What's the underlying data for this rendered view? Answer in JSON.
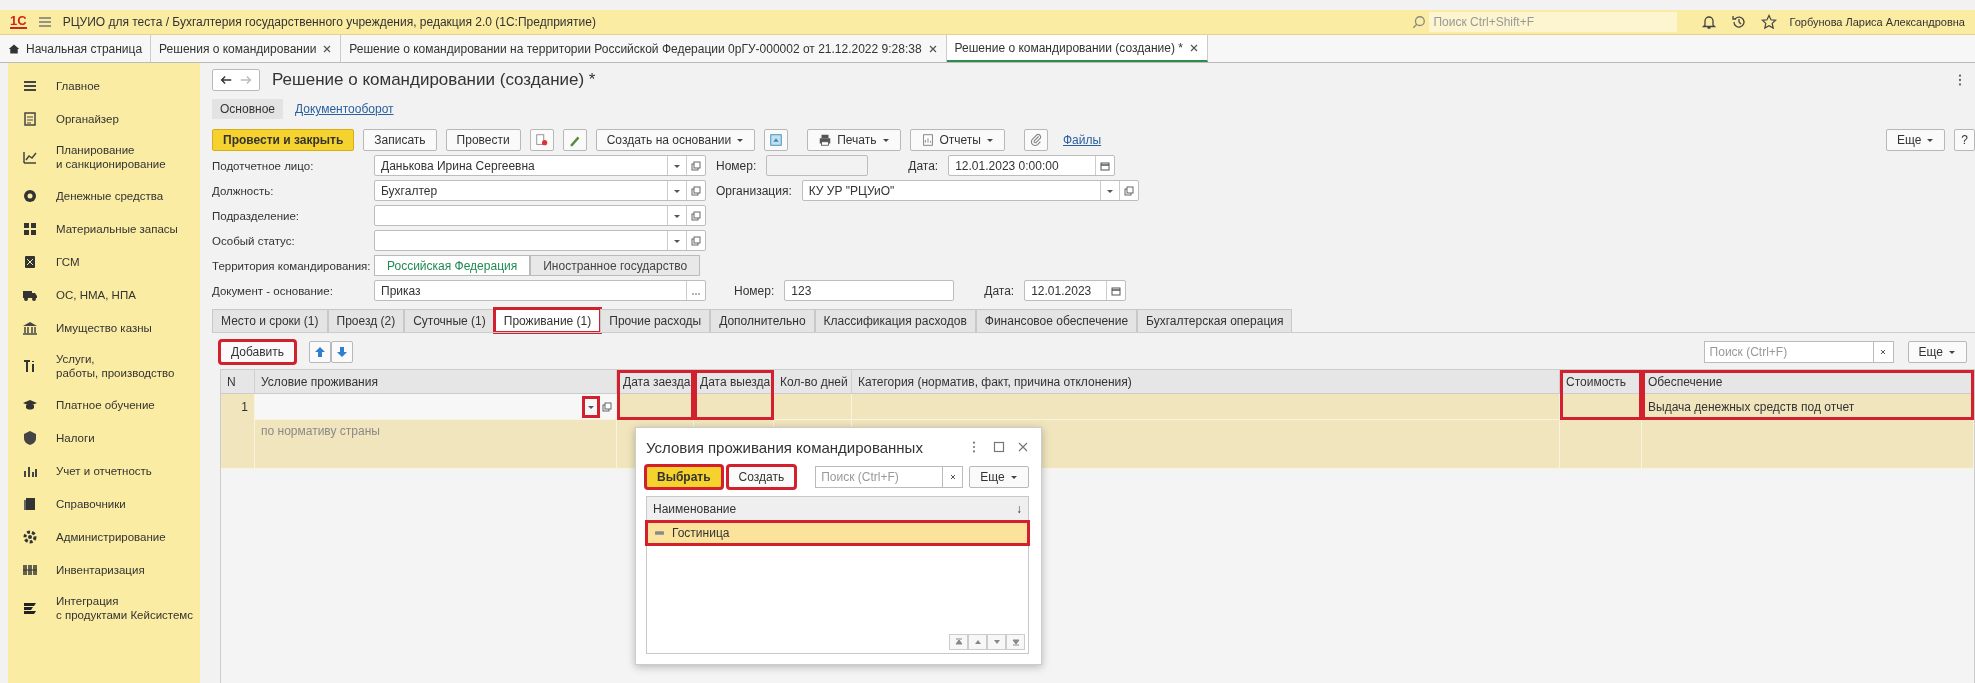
{
  "app_bar": {
    "logo": "1С",
    "title": "РЦУИО для теста / Бухгалтерия государственного учреждения, редакция 2.0  (1С:Предприятие)",
    "search_placeholder": "Поиск Ctrl+Shift+F",
    "user": "Горбунова Лариса Александровна"
  },
  "open_tabs": [
    {
      "label": "Начальная страница",
      "closable": false,
      "selected": false
    },
    {
      "label": "Решения о командировании",
      "closable": true,
      "selected": false
    },
    {
      "label": "Решение о командировании на территории Российской Федерации 0рГУ-000002 от 21.12.2022 9:28:38",
      "closable": true,
      "selected": false
    },
    {
      "label": "Решение о командировании (создание) *",
      "closable": true,
      "selected": true
    }
  ],
  "sidebar": [
    {
      "label": "Главное"
    },
    {
      "label": "Органайзер"
    },
    {
      "label": "Планирование\nи санкционирование"
    },
    {
      "label": "Денежные средства"
    },
    {
      "label": "Материальные запасы"
    },
    {
      "label": "ГСМ"
    },
    {
      "label": "ОС, НМА, НПА"
    },
    {
      "label": "Имущество казны"
    },
    {
      "label": "Услуги,\nработы, производство"
    },
    {
      "label": "Платное обучение"
    },
    {
      "label": "Налоги"
    },
    {
      "label": "Учет и отчетность"
    },
    {
      "label": "Справочники"
    },
    {
      "label": "Администрирование"
    },
    {
      "label": "Инвентаризация"
    },
    {
      "label": "Интеграция\nс продуктами Кейсистемс"
    }
  ],
  "form": {
    "title": "Решение о командировании (создание) *",
    "sections": [
      {
        "label": "Основное",
        "selected": true
      },
      {
        "label": "Документооборот",
        "selected": false
      }
    ],
    "toolbar": {
      "post_close": "Провести и закрыть",
      "save": "Записать",
      "post": "Провести",
      "create_based": "Создать на основании",
      "print": "Печать",
      "reports": "Отчеты",
      "files": "Файлы",
      "more": "Еще",
      "help": "?"
    },
    "person": {
      "label": "Подотчетное лицо:",
      "value": "Данькова Ирина Сергеевна"
    },
    "number": {
      "label": "Номер:"
    },
    "date": {
      "label": "Дата:",
      "value": "12.01.2023  0:00:00"
    },
    "position": {
      "label": "Должность:",
      "value": "Бухгалтер"
    },
    "organization": {
      "label": "Организация:",
      "value": "КУ УР \"РЦУиО\""
    },
    "department": {
      "label": "Подразделение:"
    },
    "special_status": {
      "label": "Особый статус:"
    },
    "territory": {
      "label": "Территория командирования:",
      "options": [
        {
          "label": "Российская Федерация",
          "selected": true
        },
        {
          "label": "Иностранное государство",
          "selected": false
        }
      ]
    },
    "basis": {
      "label": "Документ - основание:",
      "value": "Приказ",
      "number_label": "Номер:",
      "number": "123",
      "date_label": "Дата:",
      "date": "12.01.2023"
    },
    "tabs": [
      {
        "label": "Место и сроки (1)",
        "selected": false,
        "highlighted": false
      },
      {
        "label": "Проезд (2)",
        "selected": false,
        "highlighted": false
      },
      {
        "label": "Суточные (1)",
        "selected": false,
        "highlighted": false
      },
      {
        "label": "Проживание (1)",
        "selected": true,
        "highlighted": true
      },
      {
        "label": "Прочие расходы",
        "selected": false,
        "highlighted": false
      },
      {
        "label": "Дополнительно",
        "selected": false,
        "highlighted": false
      },
      {
        "label": "Классификация расходов",
        "selected": false,
        "highlighted": false
      },
      {
        "label": "Финансовое обеспечение",
        "selected": false,
        "highlighted": false
      },
      {
        "label": "Бухгалтерская операция",
        "selected": false,
        "highlighted": false
      }
    ],
    "table_toolbar": {
      "add": "Добавить",
      "add_highlighted": true,
      "search_placeholder": "Поиск (Ctrl+F)",
      "more": "Еще"
    },
    "table": {
      "columns": [
        {
          "label": "N",
          "highlighted": false
        },
        {
          "label": "Условие проживания",
          "highlighted": false
        },
        {
          "label": "Дата заезда",
          "highlighted": true
        },
        {
          "label": "Дата выезда",
          "highlighted": true
        },
        {
          "label": "Кол-во дней",
          "highlighted": false
        },
        {
          "label": "Категория (норматив, факт, причина отклонения)",
          "highlighted": false
        },
        {
          "label": "Стоимость",
          "highlighted": true
        },
        {
          "label": "Обеспечение",
          "highlighted": true
        }
      ],
      "rows": [
        {
          "number": "1",
          "hint": "по нормативу страны",
          "provision": "Выдача денежных средств под отчет",
          "dropdown_highlighted": true
        }
      ]
    }
  },
  "dialog": {
    "title": "Условия проживания командированных",
    "select": "Выбрать",
    "select_highlighted": true,
    "create": "Создать",
    "create_highlighted": true,
    "search_placeholder": "Поиск (Ctrl+F)",
    "more": "Еще",
    "column": "Наименование",
    "sort": "↓",
    "items": [
      {
        "label": "Гостиница",
        "selected": true,
        "highlighted": true
      }
    ]
  }
}
